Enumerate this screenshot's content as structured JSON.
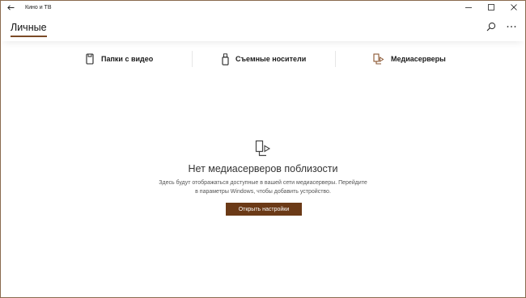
{
  "window": {
    "title": "Кино и ТВ"
  },
  "header": {
    "pivot_label": "Личные"
  },
  "sources": {
    "items": [
      {
        "label": "Папки с видео",
        "icon": "phone-folder-icon"
      },
      {
        "label": "Съемные носители",
        "icon": "usb-drive-icon"
      },
      {
        "label": "Медиасерверы",
        "icon": "media-server-icon"
      }
    ],
    "selected": "Медиасерверы"
  },
  "empty_state": {
    "icon": "media-server-icon",
    "title": "Нет медиасерверов поблизости",
    "description_line1": "Здесь будут отображаться доступные в вашей сети медиасерверы. Перейдите",
    "description_line2": "в параметры Windows, чтобы добавить устройство.",
    "button_label": "Открыть настройки"
  },
  "colors": {
    "accent": "#6b3a17",
    "selected_icon": "#8a5530",
    "window_border": "#8a6a4e"
  }
}
